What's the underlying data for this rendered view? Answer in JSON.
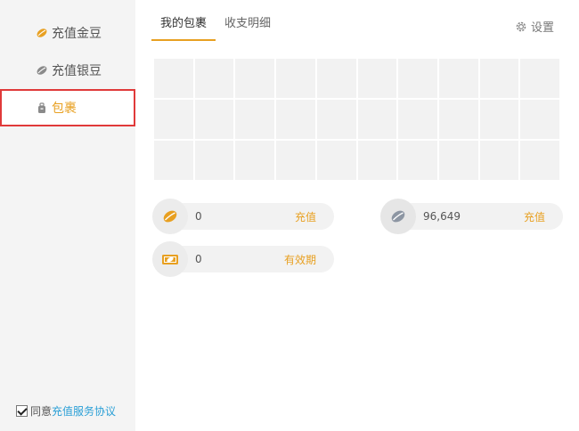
{
  "sidebar": {
    "items": [
      {
        "label": "充值金豆",
        "icon": "gold-bean-icon"
      },
      {
        "label": "充值银豆",
        "icon": "silver-bean-icon"
      },
      {
        "label": "包裹",
        "icon": "package-icon"
      }
    ],
    "agreement": {
      "prefix": "同意",
      "link": "充值服务协议",
      "checked": true
    }
  },
  "tabs": [
    {
      "label": "我的包裹",
      "active": true
    },
    {
      "label": "收支明细",
      "active": false
    }
  ],
  "settings": {
    "label": "设置",
    "icon": "gear-icon"
  },
  "balances": {
    "gold": {
      "value": "0",
      "action": "充值",
      "icon": "gold-bean-icon"
    },
    "silver": {
      "value": "96,649",
      "action": "充值",
      "icon": "silver-bean-icon"
    },
    "ticket": {
      "value": "0",
      "action": "有效期",
      "icon": "ticket-icon"
    }
  },
  "colors": {
    "accent": "#e8a021",
    "highlight_border": "#e03a3a",
    "link": "#2a9fd6"
  }
}
